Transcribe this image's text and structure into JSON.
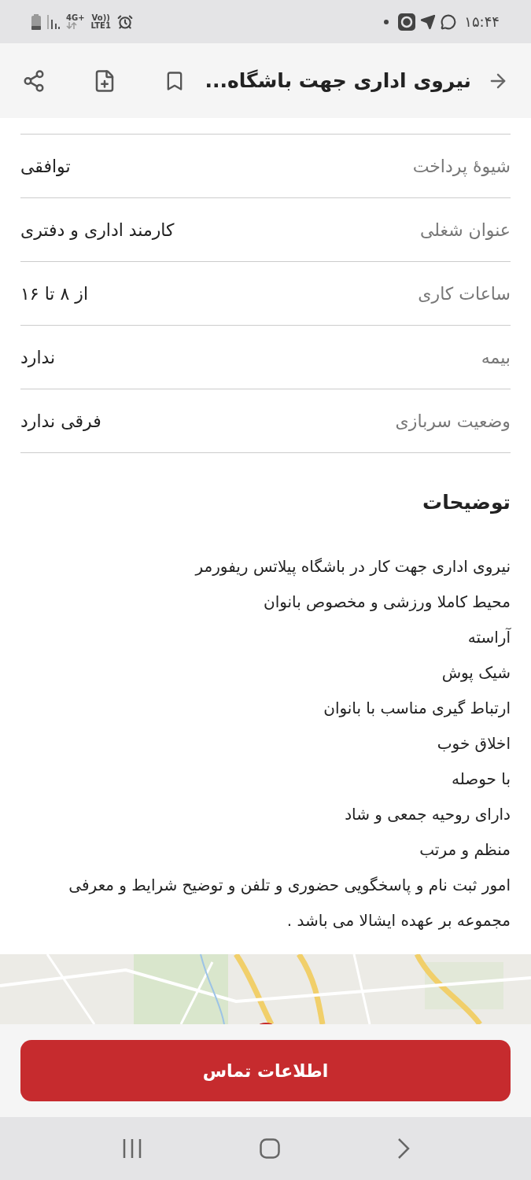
{
  "status_bar": {
    "network": "4G+",
    "voice": "Vo))",
    "lte": "LTE1",
    "time": "۱۵:۴۴"
  },
  "header": {
    "title": "نیروی اداری جهت باشگاه..."
  },
  "details": [
    {
      "label": "شیوهٔ پرداخت",
      "value": "توافقی"
    },
    {
      "label": "عنوان شغلی",
      "value": "کارمند اداری و دفتری"
    },
    {
      "label": "ساعات کاری",
      "value": "از ۸ تا ۱۶"
    },
    {
      "label": "بیمه",
      "value": "ندارد"
    },
    {
      "label": "وضعیت سربازی",
      "value": "فرقی ندارد"
    }
  ],
  "description": {
    "heading": "توضیحات",
    "lines": [
      "نیروی اداری جهت کار در باشگاه پیلاتس ریفورمر",
      "محیط کاملا ورزشی و مخصوص بانوان",
      "آراسته",
      "شیک پوش",
      "ارتباط گیری مناسب با بانوان",
      "اخلاق خوب",
      "با حوصله",
      "دارای روحیه جمعی و شاد",
      "منظم و مرتب",
      "امور ثبت نام و پاسخگویی حضوری و تلفن و توضیح شرایط و معرفی مجموعه بر عهده ایشالا می باشد ."
    ]
  },
  "contact_button": {
    "label": "اطلاعات تماس"
  }
}
